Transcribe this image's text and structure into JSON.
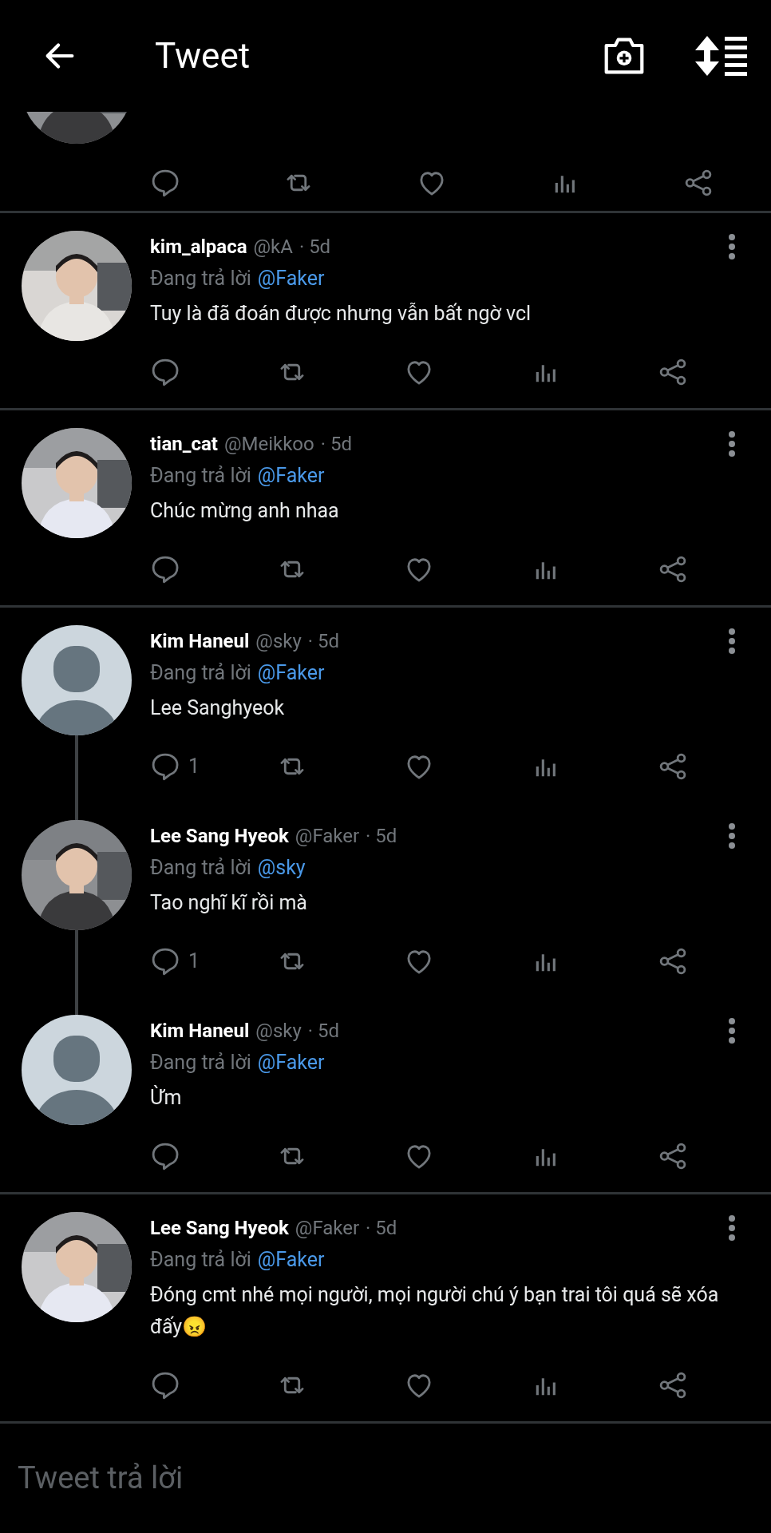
{
  "header": {
    "title": "Tweet"
  },
  "tweets": [
    {
      "name": "kim_alpaca",
      "handle": "@kA",
      "time": "· 5d",
      "reply_prefix": "Đang trả lời",
      "reply_to": "@Faker",
      "body": "Tuy là đã đoán được nhưng vẫn bất ngờ vcl",
      "thread_line": false
    },
    {
      "name": "tian_cat",
      "handle": "@Meikkoo",
      "time": "· 5d",
      "reply_prefix": "Đang trả lời",
      "reply_to": "@Faker",
      "body": "Chúc mừng anh nhaa",
      "thread_line": false
    },
    {
      "name": "Kim Haneul",
      "handle": "@sky",
      "time": "· 5d",
      "reply_prefix": "Đang trả lời",
      "reply_to": "@Faker",
      "body": "Lee Sanghyeok",
      "avatar": {
        "kind": "default"
      },
      "reply_count": "1",
      "thread_line": true
    },
    {
      "name": "Lee Sang Hyeok",
      "handle": "@Faker",
      "time": "· 5d",
      "reply_prefix": "Đang trả lời",
      "reply_to": "@sky",
      "body": "Tao nghĩ kĩ rồi mà",
      "reply_count": "1",
      "thread_line": true
    },
    {
      "name": "Kim Haneul",
      "handle": "@sky",
      "time": "· 5d",
      "reply_prefix": "Đang trả lời",
      "reply_to": "@Faker",
      "body": "Ừm",
      "avatar": {
        "kind": "default"
      },
      "thread_line": false
    },
    {
      "name": "Lee Sang Hyeok",
      "handle": "@Faker",
      "time": "· 5d",
      "reply_prefix": "Đang trả lời",
      "reply_to": "@Faker",
      "body": "Đóng cmt nhé mọi người, mọi người chú ý bạn trai tôi quá sẽ xóa đấy😠",
      "thread_line": false
    }
  ],
  "reply_box": {
    "placeholder": "Tweet trả lời"
  }
}
